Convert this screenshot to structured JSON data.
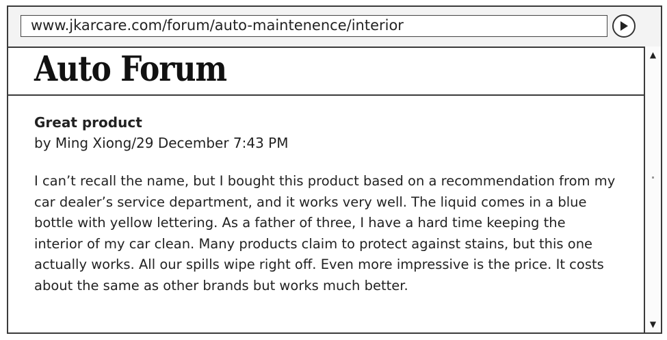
{
  "browser": {
    "url": "www.jkarcare.com/forum/auto-maintenence/interior",
    "go_icon": "play-triangle-icon",
    "scroll_up_glyph": "▲",
    "scroll_down_glyph": "▼"
  },
  "site": {
    "title": "Auto Forum"
  },
  "post": {
    "title": "Great product",
    "byline": "by Ming Xiong/29 December 7:43 PM",
    "body": "I can’t recall the name, but I bought this product based on a recommendation from my car dealer’s service department, and it works very well. The liquid comes in a blue bottle with yellow lettering. As a father of three, I have a hard time keeping the interior of my car clean. Many products claim to protect against stains, but this one actually works. All our spills wipe right off. Even more impressive is the price. It costs about the same as other brands but works much better."
  }
}
